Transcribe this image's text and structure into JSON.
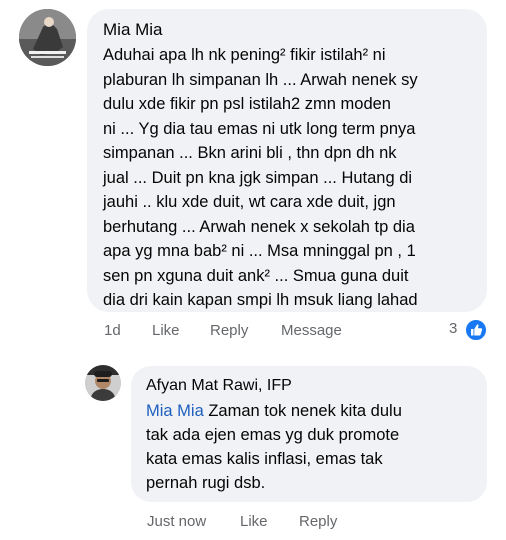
{
  "comment": {
    "author": "Mia Mia",
    "lines": [
      "Aduhai apa lh nk pening² fikir istilah² ni",
      "plaburan lh simpanan lh ... Arwah nenek sy",
      "dulu xde fikir pn psl istilah2 zmn moden",
      "ni ... Yg dia tau emas ni utk long term pnya",
      "simpanan ... Bkn arini bli , thn dpn dh nk",
      "jual ... Duit pn kna jgk simpan ... Hutang di",
      "jauhi .. klu xde duit, wt cara xde duit, jgn",
      "berhutang ... Arwah nenek x sekolah tp dia",
      "apa yg mna bab² ni ... Msa mninggal pn , 1",
      "sen pn xguna duit ank² ... Smua guna duit",
      "dia dri kain kapan smpi lh msuk liang lahad"
    ],
    "time": "1d",
    "like_label": "Like",
    "reply_label": "Reply",
    "message_label": "Message",
    "reaction_count": "3",
    "reaction_icon": "like-icon"
  },
  "reply": {
    "author": "Afyan Mat Rawi, IFP",
    "mention": "Mia Mia",
    "first_line_rest": " Zaman tok nenek kita dulu",
    "lines": [
      "tak ada ejen emas yg duk promote",
      "kata emas kalis inflasi, emas tak",
      "pernah rugi dsb."
    ],
    "time": "Just now",
    "like_label": "Like",
    "reply_label": "Reply"
  },
  "colors": {
    "bubble": "#f0f2f5",
    "secondary_text": "#65676b",
    "mention": "#1f5fbf",
    "like_badge": "#1877f2"
  }
}
